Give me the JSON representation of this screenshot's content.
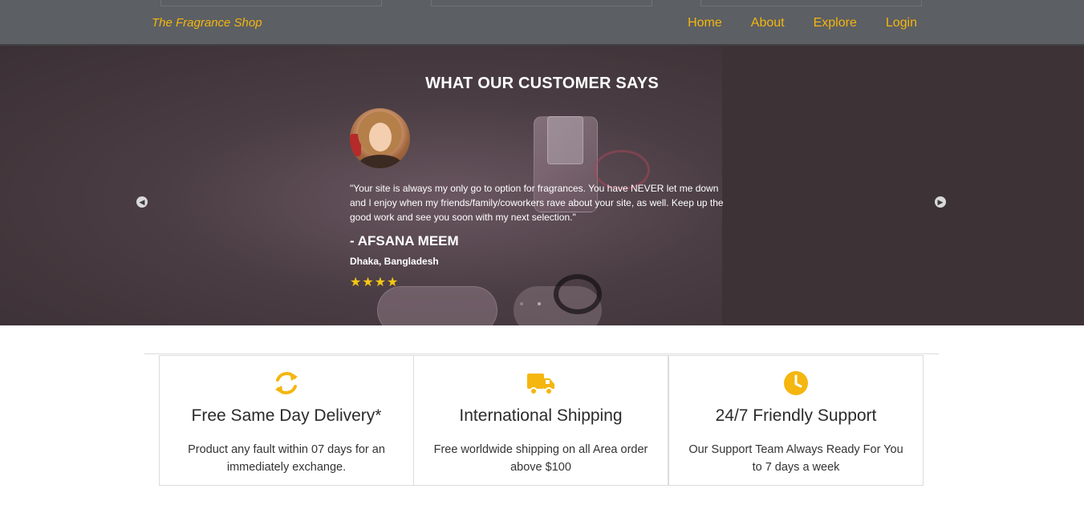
{
  "nav": {
    "brand": "The Fragrance Shop",
    "links": [
      "Home",
      "About",
      "Explore",
      "Login"
    ]
  },
  "testimonial": {
    "title": "WHAT OUR CUSTOMER SAYS",
    "quote": "\"Your site is always my only go to option for fragrances. You have NEVER let me down and I enjoy when my friends/family/coworkers rave about your site, as well. Keep up the good work and see you soon with my next selection.\"",
    "author": "- AFSANA MEEM",
    "location": "Dhaka, Bangladesh",
    "rating": 4,
    "stars": "★★★★",
    "prev_icon": "chevron-left-icon",
    "next_icon": "chevron-right-icon",
    "prev_glyph": "◀",
    "next_glyph": "▶"
  },
  "features": [
    {
      "icon": "refresh-icon",
      "title": "Free Same Day Delivery*",
      "text": "Product any fault within 07 days for an immediately exchange."
    },
    {
      "icon": "truck-icon",
      "title": "International Shipping",
      "text": "Free worldwide shipping on all Area order above $100"
    },
    {
      "icon": "clock-icon",
      "title": "24/7 Friendly Support",
      "text": "Our Support Team Always Ready For You to 7 days a week"
    }
  ],
  "colors": {
    "accent": "#f4b60f",
    "navbar": "#5c5f63",
    "star": "#f7c713"
  }
}
